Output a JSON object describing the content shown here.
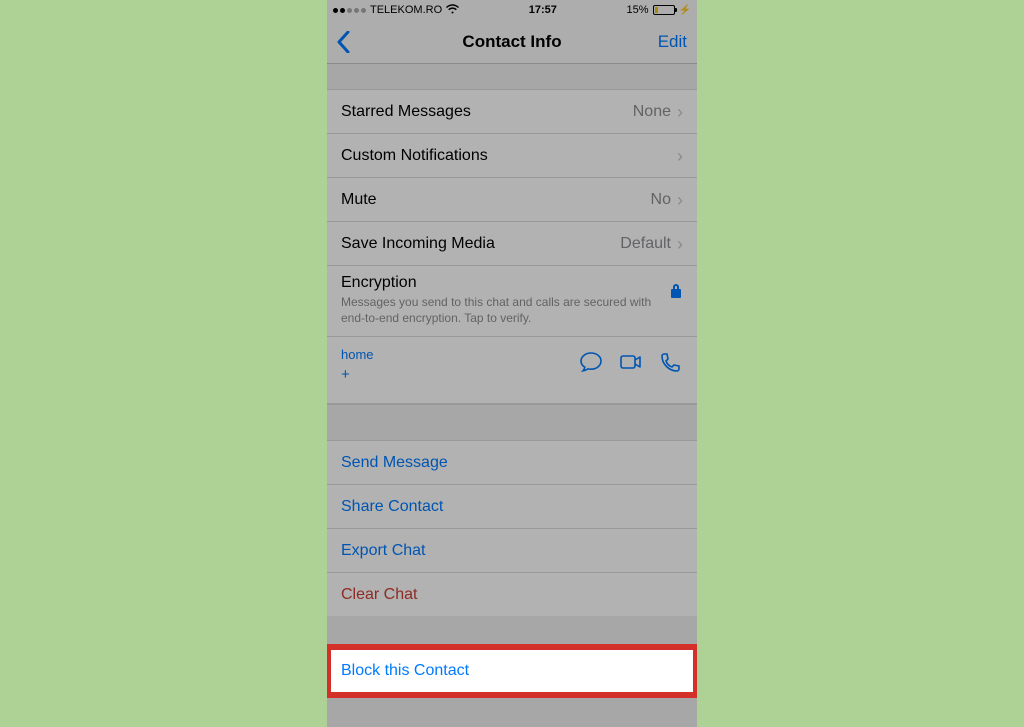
{
  "status": {
    "carrier": "TELEKOM.RO",
    "time": "17:57",
    "battery_pct": "15%"
  },
  "nav": {
    "title": "Contact Info",
    "edit": "Edit"
  },
  "rows": {
    "starred": {
      "label": "Starred Messages",
      "value": "None"
    },
    "custom_notif": {
      "label": "Custom Notifications"
    },
    "mute": {
      "label": "Mute",
      "value": "No"
    },
    "save_media": {
      "label": "Save Incoming Media",
      "value": "Default"
    },
    "encryption": {
      "title": "Encryption",
      "sub": "Messages you send to this chat and calls are secured with end-to-end encryption. Tap to verify."
    },
    "contact": {
      "label": "home",
      "number": "+"
    },
    "send_message": "Send Message",
    "share_contact": "Share Contact",
    "export_chat": "Export Chat",
    "clear_chat": "Clear Chat",
    "block": "Block this Contact"
  }
}
